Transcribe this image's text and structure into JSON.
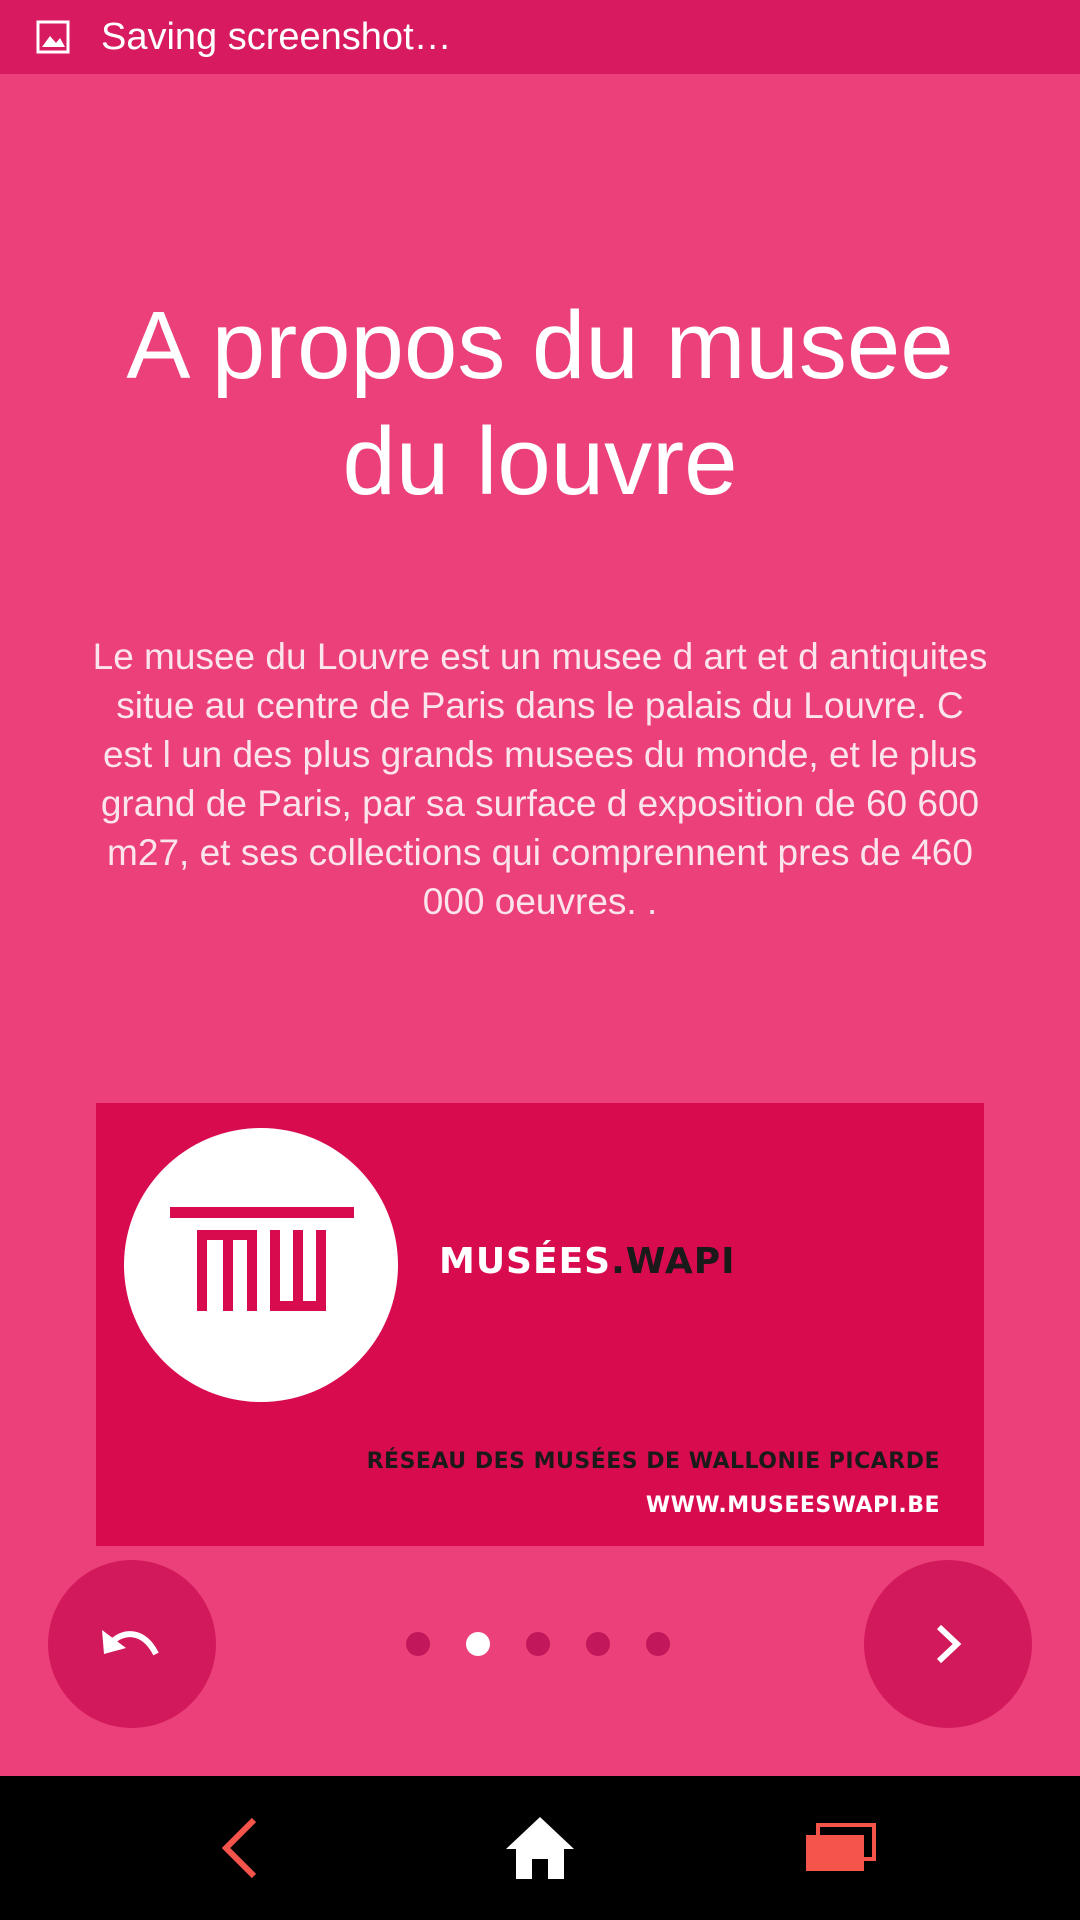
{
  "status_bar": {
    "notification_text": "Saving screenshot…",
    "icon": "image-icon"
  },
  "page": {
    "title": "A propos du musee du louvre",
    "description": "Le musee du Louvre est un musee d art et d antiquites situe au centre de Paris dans le palais du Louvre. C est l un des plus grands musees du monde, et le plus grand de Paris, par sa surface d exposition de 60 600 m27, et ses collections qui comprennent pres de 460 000 oeuvres. ."
  },
  "banner": {
    "brand_prefix": "MUSÉES",
    "brand_suffix": ".WAPI",
    "network_text": "RÉSEAU DES MUSÉES DE WALLONIE PICARDE",
    "website_text": "WWW.MUSEESWAPI.BE"
  },
  "controls": {
    "back_icon": "undo-arrow-icon",
    "next_icon": "chevron-right-icon",
    "page_count": 5,
    "active_page": 2
  },
  "nav_bar": {
    "back_icon": "back-icon",
    "home_icon": "home-icon",
    "recents_icon": "recents-icon"
  },
  "colors": {
    "background": "#EB407A",
    "status_bar": "#D81B60",
    "banner": "#D90B4F",
    "round_button": "#D2195B",
    "dot_inactive": "#C2185B",
    "dot_active": "#FFFFFF",
    "nav_accent": "#F4544A"
  }
}
